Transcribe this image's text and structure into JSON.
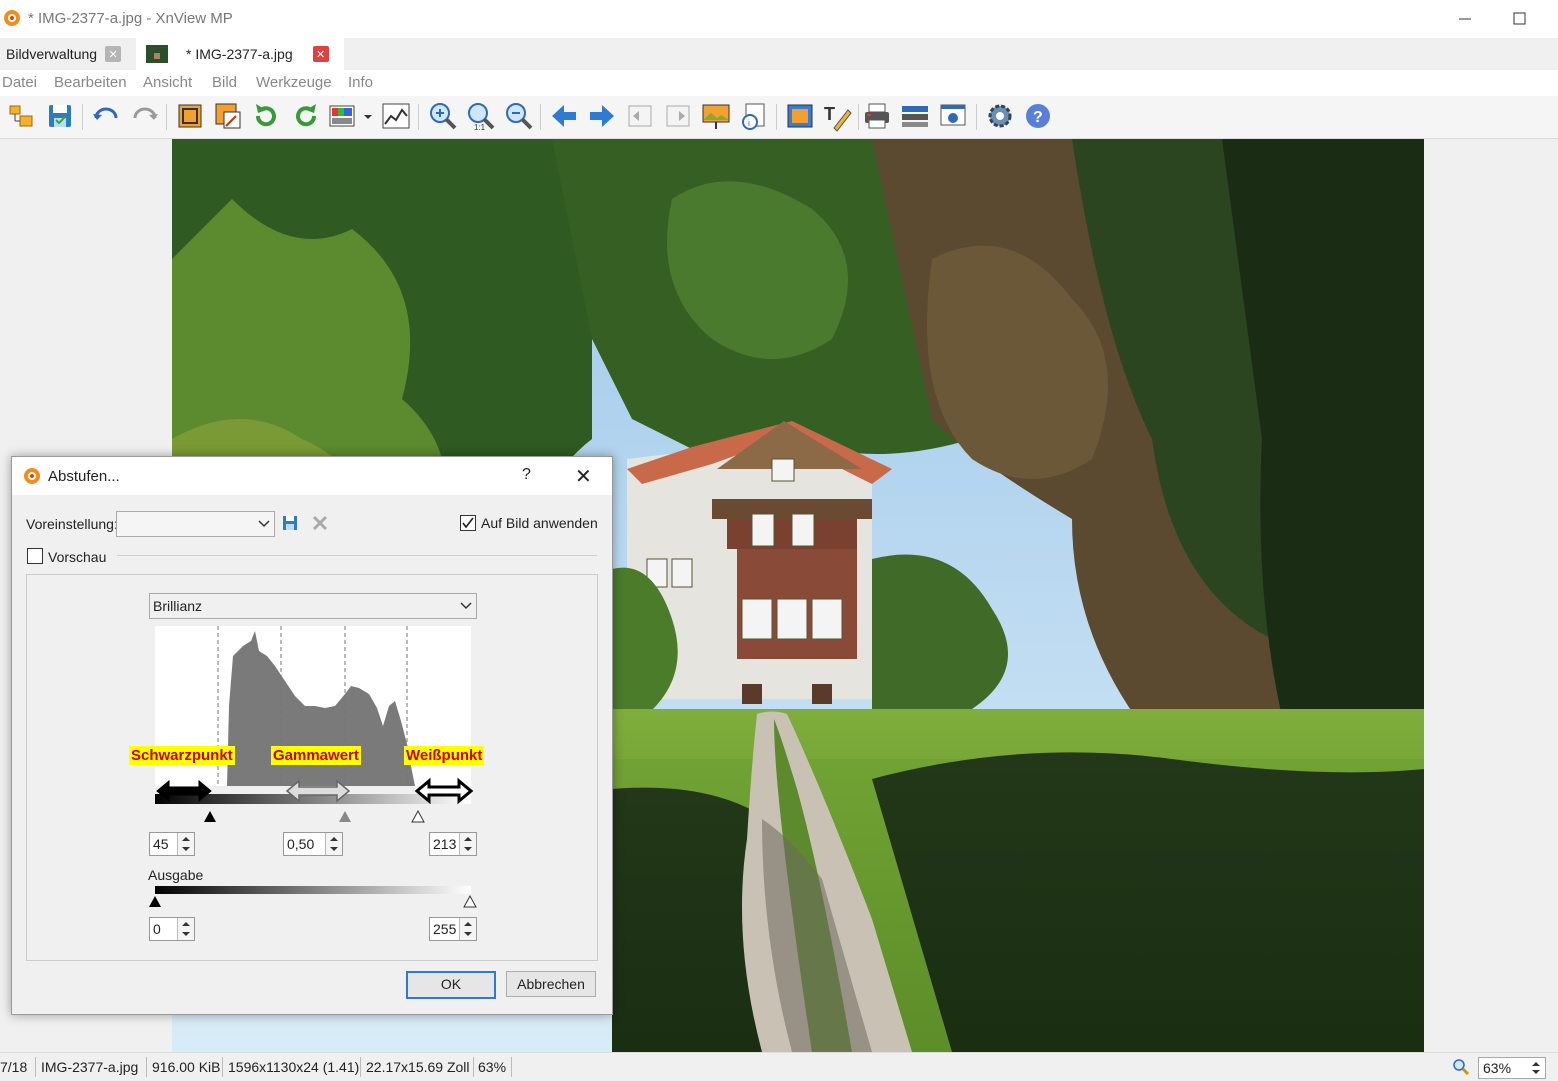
{
  "window": {
    "title": "* IMG-2377-a.jpg - XnView MP"
  },
  "tabs": [
    {
      "label": "Bildverwaltung"
    },
    {
      "label": "* IMG-2377-a.jpg"
    }
  ],
  "menu": [
    "Datei",
    "Bearbeiten",
    "Ansicht",
    "Bild",
    "Werkzeuge",
    "Info"
  ],
  "status": {
    "index": "7/18",
    "filename": "IMG-2377-a.jpg",
    "filesize": "916.00 KiB",
    "dimensions": "1596x1130x24 (1.41)",
    "print_size": "22.17x15.69 Zoll",
    "zoom": "63%"
  },
  "zoom_field": "63%",
  "dialog": {
    "title": "Abstufen...",
    "help": "?",
    "preset_label": "Voreinstellung:",
    "preset_value": "",
    "apply_label": "Auf Bild anwenden",
    "apply_checked": true,
    "preview_label": "Vorschau",
    "preview_checked": false,
    "channel": "Brillianz",
    "input_black": "45",
    "input_gamma": "0,50",
    "input_white": "213",
    "output_label": "Ausgabe",
    "output_black": "0",
    "output_white": "255",
    "ok_label": "OK",
    "cancel_label": "Abbrechen"
  },
  "annotations": {
    "black": "Schwarzpunkt",
    "gamma": "Gammawert",
    "white": "Weißpunkt"
  },
  "colors": {
    "accent": "#2f78d4",
    "close_red": "#e04040",
    "annot_bg": "#ffff00",
    "annot_text": "#cc0000"
  }
}
